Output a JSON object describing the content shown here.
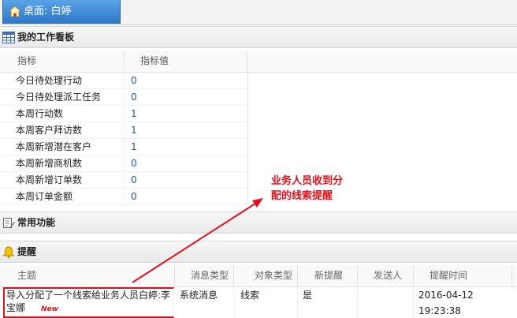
{
  "tab": {
    "label": "桌面: 白婷"
  },
  "board": {
    "title": "我的工作看板",
    "col_metric": "指标",
    "col_value": "指标值",
    "rows": [
      {
        "name": "今日待处理行动",
        "value": "0"
      },
      {
        "name": "今日待处理派工任务",
        "value": "0"
      },
      {
        "name": "本周行动数",
        "value": "1"
      },
      {
        "name": "本周客户拜访数",
        "value": "1"
      },
      {
        "name": "本周新增潜在客户",
        "value": "1"
      },
      {
        "name": "本周新增商机数",
        "value": "0"
      },
      {
        "name": "本周新增订单数",
        "value": "0"
      },
      {
        "name": "本周订单金额",
        "value": "0"
      }
    ]
  },
  "functions": {
    "title": "常用功能"
  },
  "reminders": {
    "title": "提醒",
    "columns": [
      "主题",
      "消息类型",
      "对象类型",
      "新提醒",
      "发送人",
      "提醒时间"
    ],
    "rows": [
      {
        "subject": "导入分配了一个线索给业务人员白婷:李宝娜",
        "badge": "New",
        "msg_type": "系统消息",
        "obj_type": "线索",
        "is_new": "是",
        "sender": "",
        "time": "2016-04-12 19:23:38"
      }
    ]
  },
  "annotation": {
    "text1": "业务人员收到分",
    "text2": "配的线索提醒"
  }
}
